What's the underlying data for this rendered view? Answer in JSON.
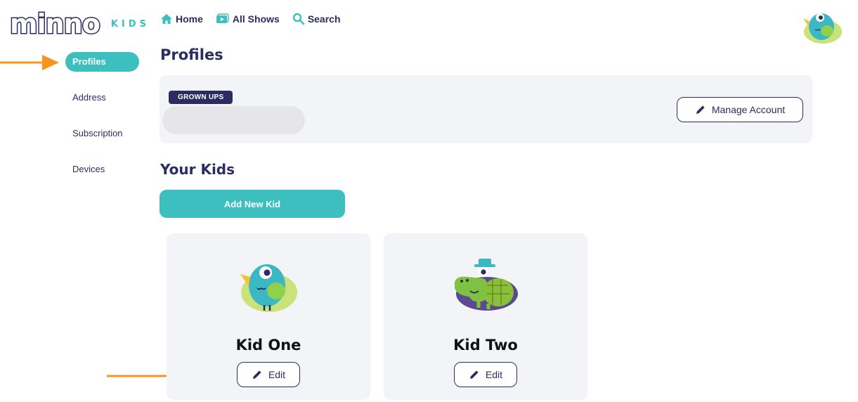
{
  "brand": {
    "logo_text": "minno",
    "logo_sub": "KIDS"
  },
  "nav": {
    "home": "Home",
    "all_shows": "All Shows",
    "search": "Search"
  },
  "sidebar": {
    "items": [
      {
        "label": "Profiles",
        "active": true
      },
      {
        "label": "Address",
        "active": false
      },
      {
        "label": "Subscription",
        "active": false
      },
      {
        "label": "Devices",
        "active": false
      }
    ]
  },
  "profiles": {
    "title": "Profiles",
    "grown_ups_badge": "GROWN UPS",
    "manage_account_label": "Manage Account"
  },
  "kids": {
    "title": "Your Kids",
    "add_button": "Add New Kid",
    "list": [
      {
        "name": "Kid One",
        "avatar_icon": "bird-avatar-icon",
        "edit_label": "Edit"
      },
      {
        "name": "Kid Two",
        "avatar_icon": "crocodile-avatar-icon",
        "edit_label": "Edit"
      }
    ]
  },
  "colors": {
    "navy": "#2b2d62",
    "teal": "#3dbfbf",
    "panel": "#f3f4f8",
    "arrow": "#f7931e"
  }
}
